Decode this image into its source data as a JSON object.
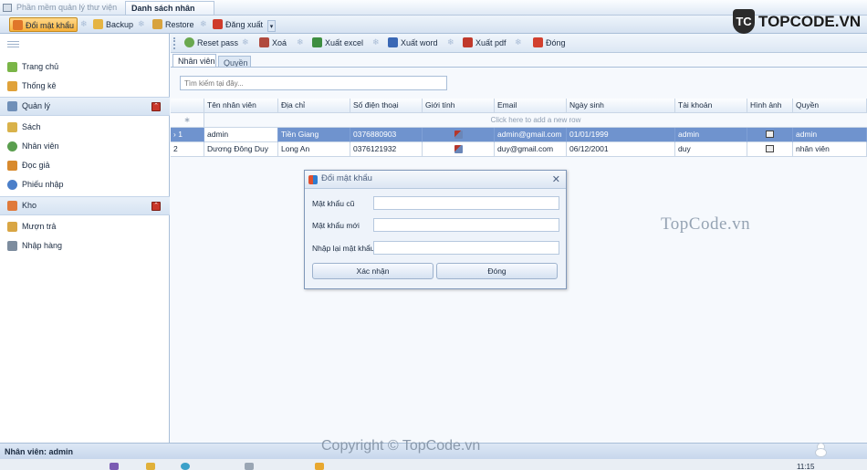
{
  "doc_tabs": {
    "app_title": "Phần mềm quản lý thư viện",
    "active_tab": "Danh sách nhân viên"
  },
  "main_toolbar": {
    "change_password": "Đổi mật khẩu",
    "backup": "Backup",
    "restore": "Restore",
    "logout": "Đăng xuất"
  },
  "logo": {
    "mark": "TC",
    "text": "TOPCODE.VN"
  },
  "sidebar": {
    "home": "Trang chủ",
    "stats": "Thống kê",
    "manage_group": "Quản lý",
    "books": "Sách",
    "staff": "Nhân viên",
    "readers": "Đọc giả",
    "import_slip": "Phiếu nhập",
    "warehouse_group": "Kho",
    "borrow_return": "Mượn trả",
    "import_goods": "Nhập hàng"
  },
  "sub_toolbar": {
    "reset_pass": "Reset pass",
    "delete": "Xoá",
    "export_excel": "Xuất excel",
    "export_word": "Xuất word",
    "export_pdf": "Xuất pdf",
    "close": "Đóng"
  },
  "inner_tabs": {
    "staff": "Nhân viên",
    "roles": "Quyền"
  },
  "search": {
    "placeholder": "Tìm kiếm tại đây..."
  },
  "grid": {
    "columns": [
      "Tên nhân viên",
      "Địa chỉ",
      "Số điện thoại",
      "Giới tính",
      "Email",
      "Ngày sinh",
      "Tài khoản",
      "Hình ảnh",
      "Quyền"
    ],
    "new_row_text": "Click here to add a new row",
    "new_row_marker": "∗",
    "rows": [
      {
        "indicator": "› 1",
        "name": "admin",
        "address": "Tiền Giang",
        "phone": "0376880903",
        "email": "admin@gmail.com",
        "dob": "01/01/1999",
        "account": "admin",
        "role": "admin"
      },
      {
        "indicator": "2",
        "name": "Dương Đông Duy",
        "address": "Long An",
        "phone": "0376121932",
        "email": "duy@gmail.com",
        "dob": "06/12/2001",
        "account": "duy",
        "role": "nhân viên"
      }
    ]
  },
  "dialog": {
    "title": "Đổi mật khẩu",
    "old_password_label": "Mật khẩu cũ",
    "new_password_label": "Mật khẩu mới",
    "confirm_password_label": "Nhập lại mật khẩu",
    "confirm_button": "Xác nhận",
    "close_button": "Đóng"
  },
  "watermark": "TopCode.vn",
  "copyright": "Copyright © TopCode.vn",
  "status_bar": {
    "user_text": "Nhân viên: admin"
  },
  "taskbar": {
    "clock": "11:15"
  }
}
